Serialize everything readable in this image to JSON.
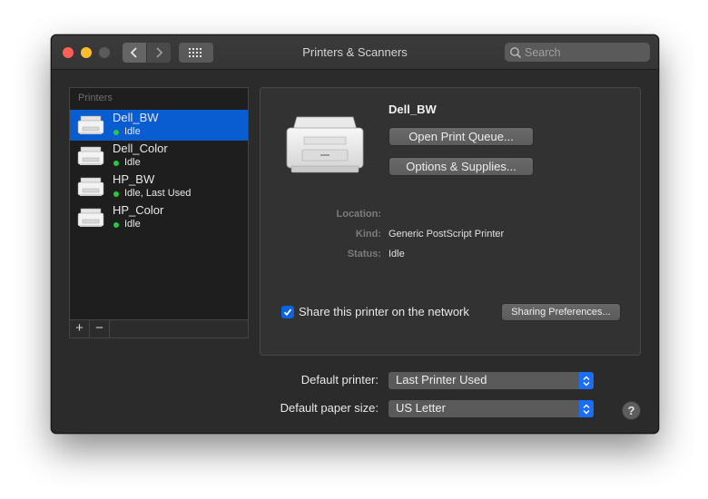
{
  "window": {
    "title": "Printers & Scanners"
  },
  "search": {
    "placeholder": "Search"
  },
  "sidebar": {
    "header": "Printers",
    "items": [
      {
        "name": "Dell_BW",
        "status": "Idle",
        "selected": true
      },
      {
        "name": "Dell_Color",
        "status": "Idle",
        "selected": false
      },
      {
        "name": "HP_BW",
        "status": "Idle, Last Used",
        "selected": false
      },
      {
        "name": "HP_Color",
        "status": "Idle",
        "selected": false
      }
    ],
    "add_label": "+",
    "remove_label": "−"
  },
  "detail": {
    "printer_name": "Dell_BW",
    "open_queue_label": "Open Print Queue...",
    "options_label": "Options & Supplies...",
    "location_label": "Location:",
    "location_value": "",
    "kind_label": "Kind:",
    "kind_value": "Generic PostScript Printer",
    "status_label": "Status:",
    "status_value": "Idle",
    "share_label": "Share this printer on the network",
    "share_checked": true,
    "sharing_prefs_label": "Sharing Preferences..."
  },
  "defaults": {
    "printer_label": "Default printer:",
    "printer_value": "Last Printer Used",
    "paper_label": "Default paper size:",
    "paper_value": "US Letter"
  },
  "help_label": "?",
  "colors": {
    "selection": "#0a5cd1",
    "status_dot": "#28c840",
    "accent": "#1b6ef3"
  }
}
